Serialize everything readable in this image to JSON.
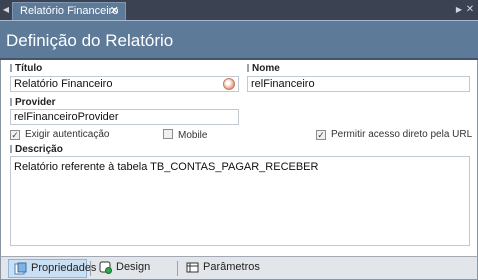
{
  "tabstrip": {
    "tab_label": "Relatório Financeiro",
    "tab_close": "✕"
  },
  "header": {
    "title": "Definição do Relatório"
  },
  "form": {
    "titulo": {
      "label": "Título",
      "value": "Relatório Financeiro"
    },
    "nome": {
      "label": "Nome",
      "value": "relFinanceiro"
    },
    "provider": {
      "label": "Provider",
      "value": "relFinanceiroProvider"
    },
    "checks": {
      "exigir_autenticacao": {
        "label": "Exigir autenticação",
        "checked": true
      },
      "mobile": {
        "label": "Mobile",
        "checked": false
      },
      "permitir_acesso": {
        "label": "Permitir acesso direto pela URL",
        "checked": true
      }
    },
    "descricao": {
      "label": "Descrição",
      "value": "Relatório referente à tabela TB_CONTAS_PAGAR_RECEBER"
    }
  },
  "bottom_tabs": [
    {
      "label": "Propriedades",
      "icon": "properties-icon",
      "active": true
    },
    {
      "label": "Design",
      "icon": "design-icon",
      "active": false
    },
    {
      "label": "Parâmetros",
      "icon": "parameters-icon",
      "active": false
    }
  ],
  "colors": {
    "header_bg": "#5d7a99",
    "tabstrip_bg": "#3b4352",
    "active_tab_bg": "#c9dff3"
  }
}
